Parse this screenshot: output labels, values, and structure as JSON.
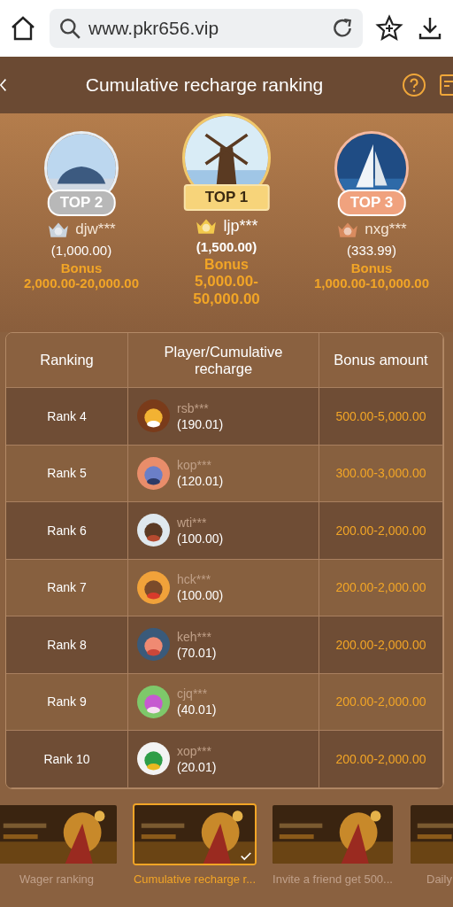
{
  "browser": {
    "url": "www.pkr656.vip"
  },
  "header": {
    "title": "Cumulative recharge ranking"
  },
  "podium": [
    {
      "kind": "silver",
      "badge": "TOP 2",
      "name": "djw***",
      "amount": "(1,000.00)",
      "bonus_label": "Bonus",
      "bonus": "2,000.00-20,000.00"
    },
    {
      "kind": "gold",
      "badge": "TOP 1",
      "name": "ljp***",
      "amount": "(1,500.00)",
      "bonus_label": "Bonus",
      "bonus": "5,000.00-50,000.00"
    },
    {
      "kind": "bronze",
      "badge": "TOP 3",
      "name": "nxg***",
      "amount": "(333.99)",
      "bonus_label": "Bonus",
      "bonus": "1,000.00-10,000.00"
    }
  ],
  "table": {
    "columns": [
      "Ranking",
      "Player/Cumulative recharge",
      "Bonus amount"
    ],
    "rows": [
      {
        "rank": "Rank 4",
        "name": "rsb***",
        "amount": "(190.01)",
        "bonus": "500.00-5,000.00"
      },
      {
        "rank": "Rank 5",
        "name": "kop***",
        "amount": "(120.01)",
        "bonus": "300.00-3,000.00"
      },
      {
        "rank": "Rank 6",
        "name": "wti***",
        "amount": "(100.00)",
        "bonus": "200.00-2,000.00"
      },
      {
        "rank": "Rank 7",
        "name": "hck***",
        "amount": "(100.00)",
        "bonus": "200.00-2,000.00"
      },
      {
        "rank": "Rank 8",
        "name": "keh***",
        "amount": "(70.01)",
        "bonus": "200.00-2,000.00"
      },
      {
        "rank": "Rank 9",
        "name": "cjq***",
        "amount": "(40.01)",
        "bonus": "200.00-2,000.00"
      },
      {
        "rank": "Rank 10",
        "name": "xop***",
        "amount": "(20.01)",
        "bonus": "200.00-2,000.00"
      }
    ]
  },
  "tabs": [
    {
      "caption": "Wager ranking",
      "selected": false
    },
    {
      "caption": "Cumulative recharge r...",
      "selected": true
    },
    {
      "caption": "Invite a friend get 500...",
      "selected": false
    },
    {
      "caption": "Daily",
      "selected": false
    }
  ]
}
